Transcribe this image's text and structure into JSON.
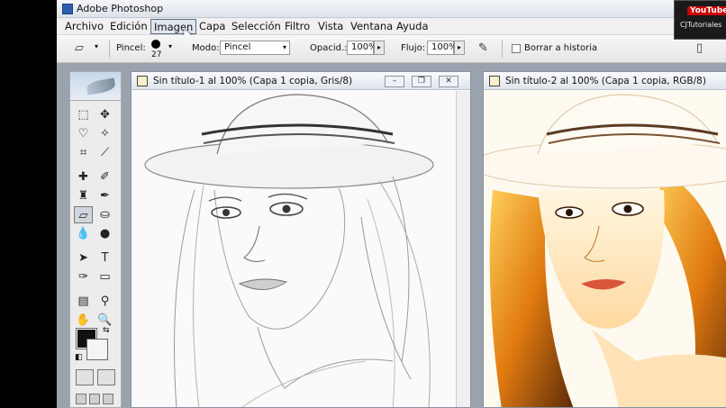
{
  "app": {
    "title": "Adobe Photoshop"
  },
  "menu": {
    "items": [
      "Archivo",
      "Edición",
      "Imagen",
      "Capa",
      "Selección",
      "Filtro",
      "Vista",
      "Ventana",
      "Ayuda"
    ],
    "active": "Imagen"
  },
  "options": {
    "brush_label": "Pincel:",
    "brush_size": "27",
    "mode_label": "Modo:",
    "mode_value": "Pincel",
    "opacity_label": "Opacid.:",
    "opacity_value": "100%",
    "flow_label": "Flujo:",
    "flow_value": "100%",
    "erase_history_label": "Borrar a historia"
  },
  "documents": [
    {
      "title": "Sin título-1 al 100% (Capa 1 copia, Gris/8)"
    },
    {
      "title": "Sin título-2 al 100% (Capa 1 copia, RGB/8)"
    }
  ],
  "window_buttons": {
    "minimize": "–",
    "restore": "❐",
    "close": "✕"
  },
  "watermark": {
    "badge": "YouTube",
    "text": "CJTutoriales"
  },
  "colors": {
    "foreground": "#111111",
    "background": "#f4f4f4",
    "accent_title": "#dfe5ec"
  }
}
